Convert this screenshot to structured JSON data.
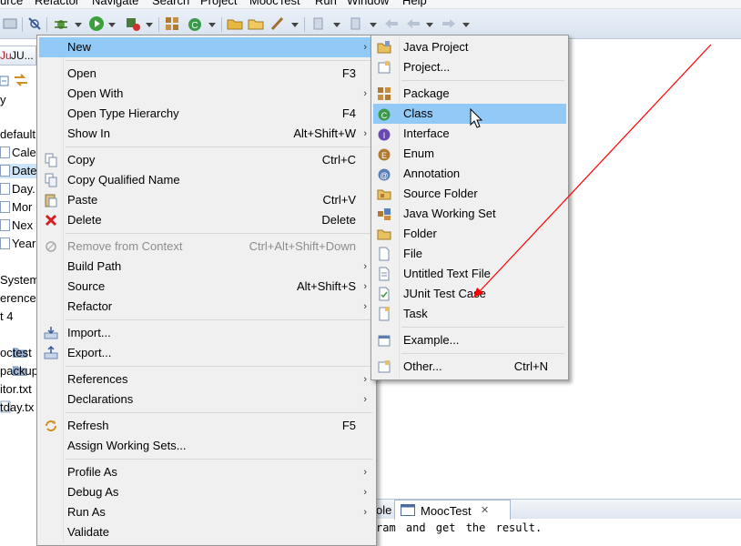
{
  "menubar": [
    "urce",
    "Refactor",
    "Navigate",
    "Search",
    "Project",
    "MoocTest",
    "Run",
    "Window",
    "Help"
  ],
  "left_tab_label": "JU...",
  "tree_items": [
    "y",
    "default",
    "Cale",
    "Date",
    "Day.",
    "Mor",
    "Nex",
    "Year",
    "System",
    "erenced",
    "t 4",
    "octest",
    "packup",
    "itor.txt",
    "tday.tx"
  ],
  "context_menu": {
    "new": "New",
    "open": "Open",
    "open_key": "F3",
    "open_with": "Open With",
    "open_type_hierarchy": "Open Type Hierarchy",
    "open_type_hierarchy_key": "F4",
    "show_in": "Show In",
    "show_in_key": "Alt+Shift+W",
    "copy": "Copy",
    "copy_key": "Ctrl+C",
    "copy_qualified_name": "Copy Qualified Name",
    "paste": "Paste",
    "paste_key": "Ctrl+V",
    "delete": "Delete",
    "delete_key": "Delete",
    "remove_from_context": "Remove from Context",
    "remove_from_context_key": "Ctrl+Alt+Shift+Down",
    "build_path": "Build Path",
    "source": "Source",
    "source_key": "Alt+Shift+S",
    "refactor": "Refactor",
    "import": "Import...",
    "export": "Export...",
    "references": "References",
    "declarations": "Declarations",
    "refresh": "Refresh",
    "refresh_key": "F5",
    "assign_working_sets": "Assign Working Sets...",
    "profile_as": "Profile As",
    "debug_as": "Debug As",
    "run_as": "Run As",
    "validate": "Validate",
    "submenu_arrow": "›"
  },
  "new_submenu": {
    "java_project": "Java Project",
    "project": "Project...",
    "package": "Package",
    "class": "Class",
    "interface": "Interface",
    "enum": "Enum",
    "annotation": "Annotation",
    "source_folder": "Source Folder",
    "java_working_set": "Java Working Set",
    "folder": "Folder",
    "file": "File",
    "untitled_text_file": "Untitled Text File",
    "junit_test_case": "JUnit Test Case",
    "task": "Task",
    "example": "Example...",
    "other": "Other...",
    "other_key": "Ctrl+N"
  },
  "console": {
    "tab_partial": "ole",
    "tab_label": "MoocTest",
    "close_glyph": "✕",
    "text": "ram and get the result."
  },
  "colors": {
    "menu_highlight": "#91c9f7",
    "annotation_arrow": "#ff0000",
    "toolbar_bg": "#dde6f1"
  }
}
